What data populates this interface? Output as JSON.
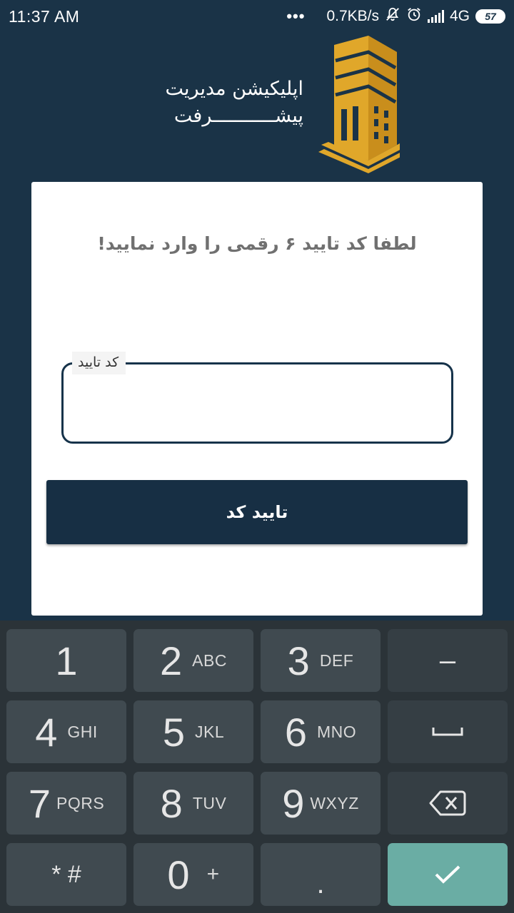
{
  "status_bar": {
    "time": "11:37  AM",
    "dots": "•••",
    "speed": "0.7KB/s",
    "network": "4G",
    "battery": "57",
    "icons": [
      "mute-icon",
      "alarm-icon",
      "signal-icon",
      "battery-icon"
    ]
  },
  "logo": {
    "line1": "اپلیکیشن مدیریت",
    "line2": "پیشـــــــــــرفت",
    "brand_color": "#e0a72a"
  },
  "card": {
    "heading": "لطفا کد تایید ۶ رقمی را وارد نمایید!",
    "field_label": "کد تایید",
    "field_value": "",
    "button_label": "تایید کد"
  },
  "keyboard": {
    "keys": [
      {
        "num": "1",
        "letters": ""
      },
      {
        "num": "2",
        "letters": "ABC"
      },
      {
        "num": "3",
        "letters": "DEF"
      },
      {
        "num": "4",
        "letters": "GHI"
      },
      {
        "num": "5",
        "letters": "JKL"
      },
      {
        "num": "6",
        "letters": "MNO"
      },
      {
        "num": "7",
        "letters": "PQRS"
      },
      {
        "num": "8",
        "letters": "TUV"
      },
      {
        "num": "9",
        "letters": "WXYZ"
      },
      {
        "num": "0",
        "letters": "+"
      }
    ],
    "star_hash": "* #",
    "period": ".",
    "minus": "–",
    "colors": {
      "key": "#404a50",
      "done": "#6aada4",
      "background": "#2b3338"
    }
  },
  "colors": {
    "background": "#1a3347",
    "button": "#172f44",
    "field_border": "#16334a"
  }
}
